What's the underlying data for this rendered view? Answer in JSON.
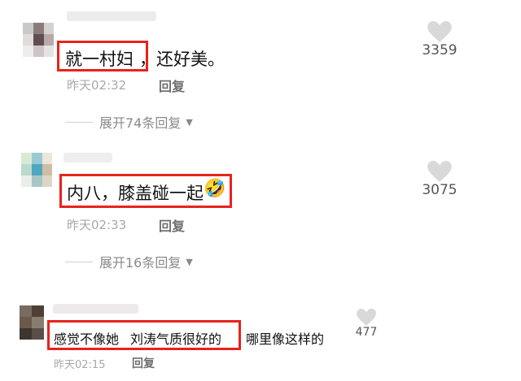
{
  "comments": [
    {
      "text": "就一村妇",
      "text_rest": "，还好美。",
      "time": "昨天02:32",
      "reply_label": "回复",
      "expand_label": "展开74条回复",
      "likes": "3359"
    },
    {
      "text": "内八，膝盖碰一起",
      "emoji": "🤣",
      "time": "昨天02:33",
      "reply_label": "回复",
      "expand_label": "展开16条回复",
      "likes": "3075"
    },
    {
      "text_pre": "感觉不像她",
      "text": "刘涛气质很好的",
      "text_rest": "哪里像这样的",
      "time": "昨天02:15",
      "reply_label": "回复",
      "likes": "477"
    }
  ],
  "colors": {
    "highlight": "#e8231c",
    "meta": "#a8a8a8",
    "heart": "#d9d9d9"
  }
}
